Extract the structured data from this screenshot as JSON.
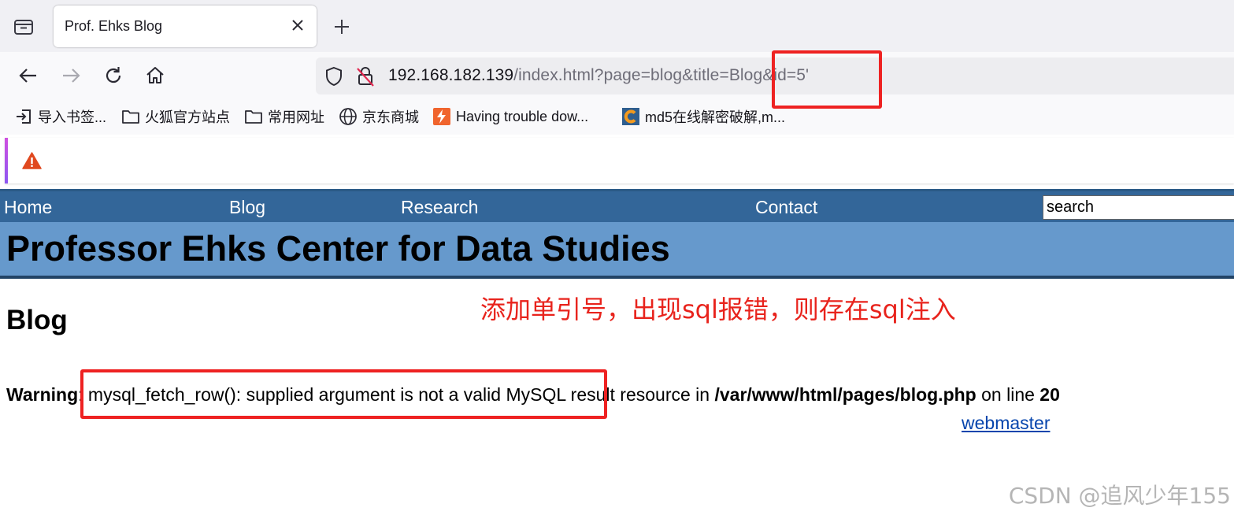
{
  "browser": {
    "tab": {
      "title": "Prof. Ehks Blog"
    },
    "url": {
      "host": "192.168.182.139",
      "path": "/index.html?page=blog&title=Blog&id=5'"
    },
    "bookmarks": [
      {
        "label": "导入书签...",
        "icon": "import-icon"
      },
      {
        "label": "火狐官方站点",
        "icon": "folder-icon"
      },
      {
        "label": "常用网址",
        "icon": "folder-icon"
      },
      {
        "label": "京东商城",
        "icon": "globe-icon"
      },
      {
        "label": "Having trouble dow...",
        "icon": "bolt-favicon"
      },
      {
        "label": "md5在线解密破解,m...",
        "icon": "cmd5-favicon"
      }
    ]
  },
  "site": {
    "nav": {
      "home": "Home",
      "blog": "Blog",
      "research": "Research",
      "contact": "Contact"
    },
    "search_value": "search",
    "title": "Professor Ehks Center for Data Studies",
    "heading": "Blog",
    "warning": {
      "label": "Warning",
      "message": ": mysql_fetch_row(): supplied argument is not a valid MySQL result resource in ",
      "file": "/var/www/html/pages/blog.php",
      "mid": " on line ",
      "line": "20"
    },
    "webmaster": "webmaster"
  },
  "annotation": "添加单引号，出现sql报错，则存在sql注入",
  "watermark": "CSDN @追风少年155",
  "colors": {
    "nav": "#336699",
    "header": "#6699cc",
    "annotation": "#e8231c",
    "highlight_box": "#ee2222"
  }
}
